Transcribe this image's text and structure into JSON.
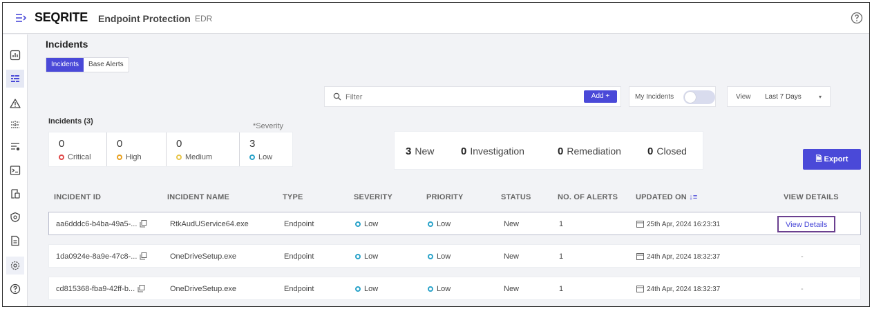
{
  "header": {
    "brand": "SEQRITE",
    "product": "Endpoint Protection",
    "edition": "EDR"
  },
  "sidebar": {
    "items": [
      {
        "icon": "dashboard-chart-icon"
      },
      {
        "icon": "incidents-list-icon",
        "active": true
      },
      {
        "icon": "warning-triangle-icon"
      },
      {
        "icon": "network-icon"
      },
      {
        "icon": "filter-settings-icon"
      },
      {
        "icon": "terminal-icon"
      },
      {
        "icon": "device-icon"
      },
      {
        "icon": "shield-icon"
      },
      {
        "icon": "document-icon"
      },
      {
        "icon": "gear-icon"
      },
      {
        "icon": "help-icon"
      }
    ]
  },
  "page": {
    "title": "Incidents",
    "tabs": [
      "Incidents",
      "Base Alerts"
    ]
  },
  "toolbar": {
    "filter_placeholder": "Filter",
    "add_label": "Add +",
    "my_incidents_label": "My Incidents",
    "view_label": "View",
    "view_value": "Last 7 Days",
    "export_label": "Export"
  },
  "summary": {
    "incident_count_label": "Incidents (3)",
    "severity_note": "*Severity",
    "severities": [
      {
        "count": "0",
        "label": "Critical",
        "color": "#e04848"
      },
      {
        "count": "0",
        "label": "High",
        "color": "#e8a020"
      },
      {
        "count": "0",
        "label": "Medium",
        "color": "#e8c64a"
      },
      {
        "count": "3",
        "label": "Low",
        "color": "#2aa3c9"
      }
    ],
    "statuses": [
      {
        "count": "3",
        "label": "New"
      },
      {
        "count": "0",
        "label": "Investigation"
      },
      {
        "count": "0",
        "label": "Remediation"
      },
      {
        "count": "0",
        "label": "Closed"
      }
    ]
  },
  "table": {
    "columns": [
      "INCIDENT ID",
      "INCIDENT NAME",
      "TYPE",
      "SEVERITY",
      "PRIORITY",
      "STATUS",
      "NO. OF ALERTS",
      "UPDATED ON",
      "VIEW DETAILS"
    ],
    "rows": [
      {
        "id": "aa6dddc6-b4ba-49a5-...",
        "name": "RtkAudUService64.exe",
        "type": "Endpoint",
        "severity": "Low",
        "priority": "Low",
        "status": "New",
        "alerts": "1",
        "updated": "25th Apr, 2024 16:23:31",
        "details": "View Details"
      },
      {
        "id": "1da0924e-8a9e-47c8-...",
        "name": "OneDriveSetup.exe",
        "type": "Endpoint",
        "severity": "Low",
        "priority": "Low",
        "status": "New",
        "alerts": "1",
        "updated": "24th Apr, 2024 18:32:37",
        "details": "-"
      },
      {
        "id": "cd815368-fba9-42ff-b...",
        "name": "OneDriveSetup.exe",
        "type": "Endpoint",
        "severity": "Low",
        "priority": "Low",
        "status": "New",
        "alerts": "1",
        "updated": "24th Apr, 2024 18:32:37",
        "details": "-"
      }
    ]
  },
  "colors": {
    "accent": "#4a49d8",
    "low": "#2aa3c9"
  }
}
